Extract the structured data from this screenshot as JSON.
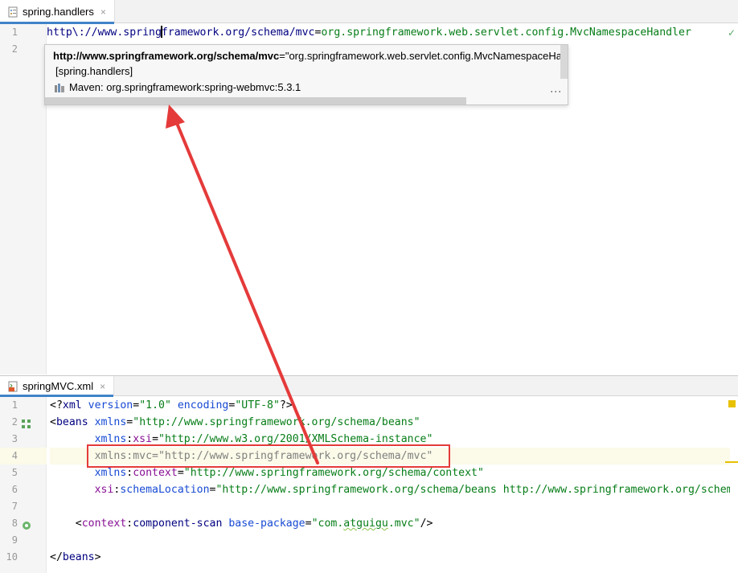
{
  "top_tab": {
    "label": "spring.handlers",
    "icon": "properties-file-icon",
    "close_glyph": "×"
  },
  "top_editor": {
    "line_numbers": [
      "1",
      "2"
    ],
    "line1": {
      "key_before_caret": "http\\://www.spring",
      "key_after_caret": "framework.org/schema/mvc",
      "eq": "=",
      "value": "org.springframework.web.servlet.config.MvcNamespaceHandler"
    }
  },
  "popup": {
    "title_bold": "http://www.springframework.org/schema/mvc",
    "title_rest": "=\"org.springframework.web.servlet.config.MvcNamespaceHandler\"",
    "file": "[spring.handlers]",
    "maven": "Maven: org.springframework:spring-webmvc:5.3.1",
    "more_glyph": "⋮"
  },
  "bottom_tab": {
    "label": "springMVC.xml",
    "icon": "xml-file-icon",
    "close_glyph": "×"
  },
  "bottom_editor": {
    "line_numbers": [
      "1",
      "2",
      "3",
      "4",
      "5",
      "6",
      "7",
      "8",
      "9",
      "10"
    ],
    "l1": {
      "open": "<?",
      "tag": "xml",
      "a1": " version",
      "eq1": "=",
      "v1": "\"1.0\"",
      "a2": " encoding",
      "eq2": "=",
      "v2": "\"UTF-8\"",
      "close": "?>"
    },
    "l2": {
      "open": "<",
      "tag": "beans",
      "attr": " xmlns",
      "eq": "=",
      "val": "\"http://www.springframework.org/schema/beans\""
    },
    "l3": {
      "indent": "       ",
      "pre": "xmlns",
      "colon": ":",
      "attr": "xsi",
      "eq": "=",
      "val": "\"http://www.w3.org/2001/XMLSchema-instance\""
    },
    "l4": {
      "indent": "       ",
      "text": "xmlns:mvc=\"http://www.springframework.org/schema/mvc\""
    },
    "l5": {
      "indent": "       ",
      "pre": "xmlns",
      "colon": ":",
      "attr": "context",
      "eq": "=",
      "val": "\"http://www.springframework.org/schema/context\""
    },
    "l6": {
      "indent": "       ",
      "pre": "xsi",
      "colon": ":",
      "attr": "schemaLocation",
      "eq": "=",
      "val": "\"http://www.springframework.org/schema/beans http://www.springframework.org/schem"
    },
    "l8": {
      "indent": "    ",
      "open": "<",
      "pre": "context",
      "colon": ":",
      "tag": "component-scan",
      "attr": " base-package",
      "eq": "=",
      "val_q1": "\"com.",
      "val_squig": "atguigu",
      "val_rest": ".mvc\"",
      "close": "/>"
    },
    "l10": {
      "open": "</",
      "tag": "beans",
      "close": ">"
    }
  },
  "colors": {
    "annotation_red": "#e53a3a",
    "inspection_yellow": "#e8c100",
    "ok_green": "#59a869"
  },
  "status": {
    "check_glyph": "✓"
  }
}
